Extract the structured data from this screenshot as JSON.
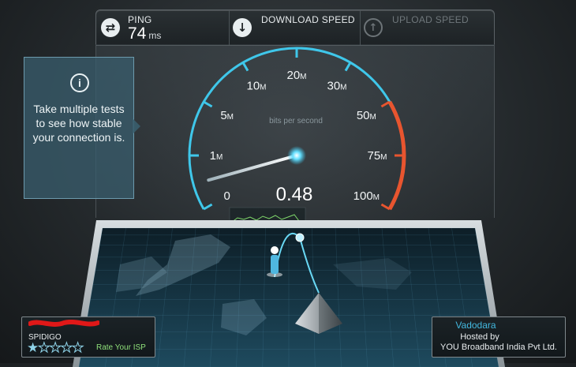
{
  "header": {
    "ping": {
      "label": "PING",
      "value": "74",
      "unit": "ms"
    },
    "download": {
      "label": "DOWNLOAD SPEED"
    },
    "upload": {
      "label": "UPLOAD SPEED"
    }
  },
  "gauge": {
    "caption": "bits per second",
    "current_value": "0.48",
    "needle_value_mbps": 0.48,
    "ticks": [
      {
        "label": "0",
        "unit": ""
      },
      {
        "label": "1",
        "unit": "M"
      },
      {
        "label": "5",
        "unit": "M"
      },
      {
        "label": "10",
        "unit": "M"
      },
      {
        "label": "20",
        "unit": "M"
      },
      {
        "label": "30",
        "unit": "M"
      },
      {
        "label": "50",
        "unit": "M"
      },
      {
        "label": "75",
        "unit": "M"
      },
      {
        "label": "100",
        "unit": "M"
      }
    ]
  },
  "info": {
    "icon": "info-icon",
    "text": "Take multiple tests to see how stable your connection is."
  },
  "isp": {
    "name": "SPIDIGO",
    "rating_stars": 1,
    "rating_max": 5,
    "rate_label": "Rate Your ISP"
  },
  "server": {
    "city": "Vadodara",
    "hosted_by": "Hosted by",
    "host": "YOU Broadband India Pvt Ltd."
  },
  "colors": {
    "accent": "#3fc7ea",
    "danger": "#e8552f",
    "panel": "#1d2225"
  }
}
